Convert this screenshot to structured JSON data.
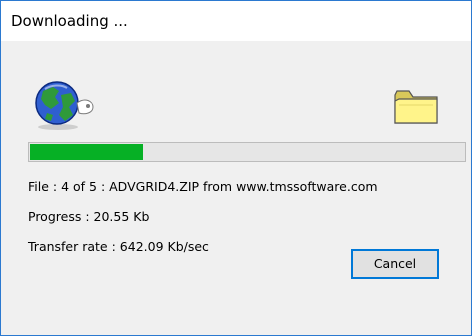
{
  "window": {
    "title": "Downloading ..."
  },
  "icons": {
    "source": "globe-icon",
    "destination": "folder-icon"
  },
  "progress": {
    "fraction": 0.26,
    "color": "#06b025"
  },
  "info": {
    "file_line": "File : 4 of 5 : ADVGRID4.ZIP from www.tmssoftware.com",
    "progress_line": "Progress : 20.55 Kb",
    "rate_line": "Transfer rate : 642.09 Kb/sec"
  },
  "buttons": {
    "cancel_label": "Cancel"
  },
  "colors": {
    "accent": "#0078d7",
    "window_border": "#2b79d0"
  }
}
